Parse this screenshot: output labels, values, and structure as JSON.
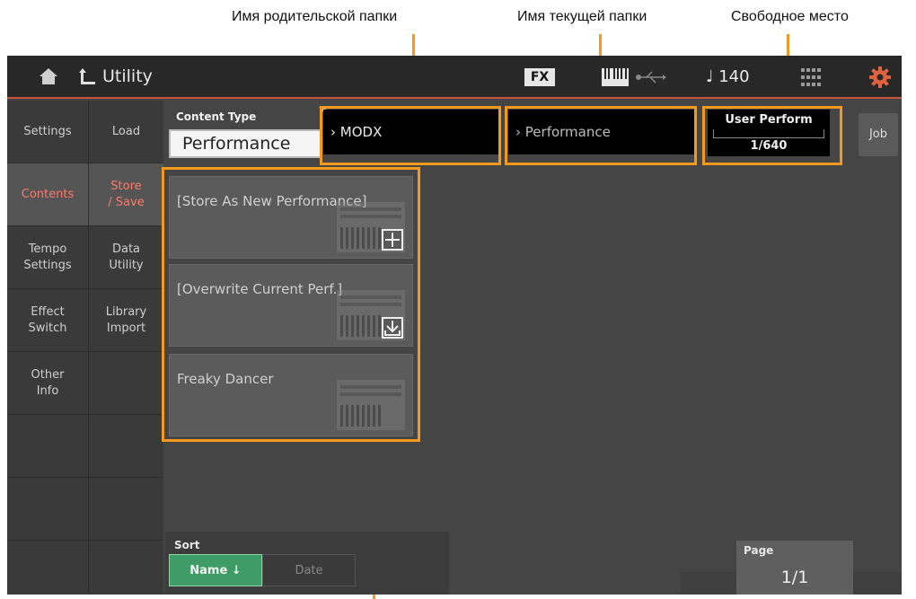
{
  "annotations": {
    "parent_folder": "Имя родительской папки",
    "current_folder": "Имя текущей папки",
    "free_space": "Свободное место"
  },
  "topbar": {
    "title": "Utility",
    "fx_label": "FX",
    "tempo": "♩ 140",
    "icons": [
      "home-icon",
      "back-arrow-icon",
      "keyboard-icon",
      "usb-icon",
      "quick-access-grid-icon",
      "gear-icon"
    ]
  },
  "nav_col1": [
    "Settings",
    "Contents",
    "Tempo\nSettings",
    "Effect\nSwitch",
    "Other\nInfo"
  ],
  "nav_col2": [
    "Load",
    "Store\n/ Save",
    "Data\nUtility",
    "Library\nImport"
  ],
  "content_type": {
    "label": "Content Type",
    "value": "Performance"
  },
  "parent_folder": "MODX",
  "current_folder": "Performance",
  "free_space": {
    "label": "User Perform",
    "value": "1/640"
  },
  "job_button": "Job",
  "items": [
    {
      "label": "[Store As New Performance]",
      "badge": "plus-icon"
    },
    {
      "label": "[Overwrite Current Perf.]",
      "badge": "download-icon"
    },
    {
      "label": "Freaky Dancer",
      "badge": ""
    }
  ],
  "sort": {
    "label": "Sort",
    "name_label": "Name ↓",
    "date_label": "Date"
  },
  "page": {
    "label": "Page",
    "value": "1/1"
  },
  "colors": {
    "accent": "#f39a1e",
    "selected_nav": "#ff7a68",
    "sort_active": "#3e9d66"
  }
}
